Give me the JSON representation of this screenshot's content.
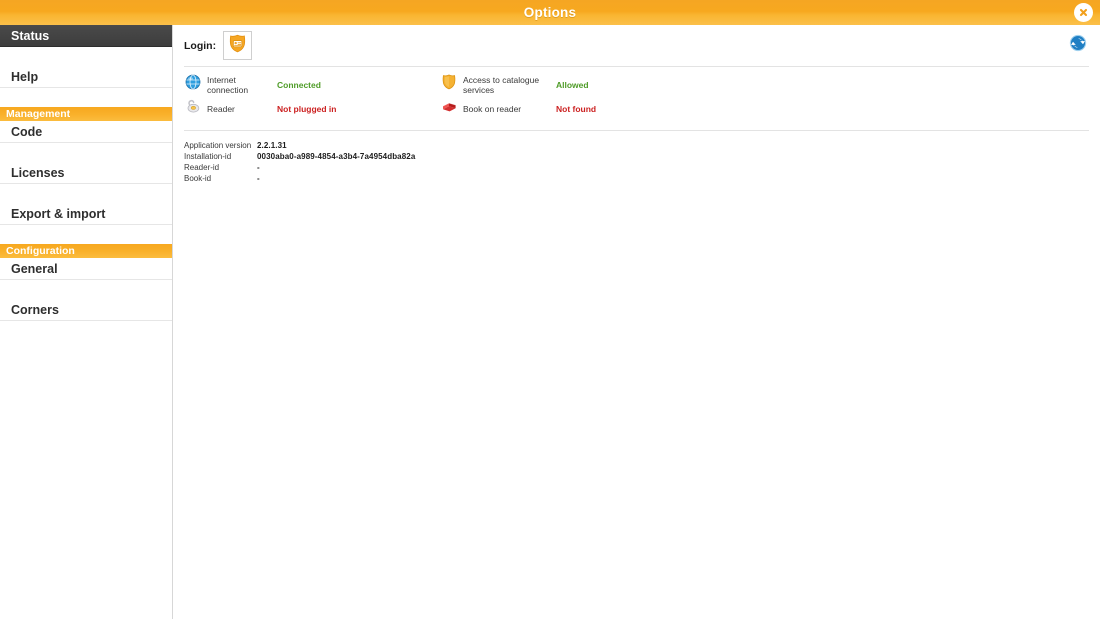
{
  "window": {
    "title": "Options",
    "close_icon": "close-icon",
    "accent": "#f7a81f",
    "active_nav_bg": "#434343"
  },
  "sidebar": {
    "items": [
      {
        "type": "item",
        "label": "Status",
        "active": true,
        "name": "sidebar-item-status"
      },
      {
        "type": "item",
        "label": "Help",
        "active": false,
        "name": "sidebar-item-help"
      },
      {
        "type": "section",
        "label": "Management",
        "active": false,
        "name": "sidebar-section-management"
      },
      {
        "type": "item",
        "label": "Code",
        "active": false,
        "name": "sidebar-item-code"
      },
      {
        "type": "item",
        "label": "Licenses",
        "active": false,
        "name": "sidebar-item-licenses"
      },
      {
        "type": "item",
        "label": "Export & import",
        "active": false,
        "name": "sidebar-item-export-import"
      },
      {
        "type": "section",
        "label": "Configuration",
        "active": false,
        "name": "sidebar-section-configuration"
      },
      {
        "type": "item",
        "label": "General",
        "active": false,
        "name": "sidebar-item-general"
      },
      {
        "type": "item",
        "label": "Corners",
        "active": false,
        "name": "sidebar-item-corners"
      }
    ]
  },
  "main": {
    "login": {
      "label": "Login:",
      "icon": "login-shield-card-icon"
    },
    "refresh_icon": "refresh-icon",
    "status": {
      "rows": [
        {
          "left": {
            "icon": "globe-icon",
            "label": "Internet connection",
            "value": "Connected",
            "state": "ok"
          },
          "right": {
            "icon": "shield-icon",
            "label": "Access to catalogue services",
            "value": "Allowed",
            "state": "ok"
          }
        },
        {
          "left": {
            "icon": "reader-icon",
            "label": "Reader",
            "value": "Not plugged in",
            "state": "bad"
          },
          "right": {
            "icon": "book-icon",
            "label": "Book on reader",
            "value": "Not found",
            "state": "bad"
          }
        }
      ]
    },
    "info": {
      "rows": [
        {
          "key": "Application version",
          "value": "2.2.1.31"
        },
        {
          "key": "Installation-id",
          "value": "0030aba0-a989-4854-a3b4-7a4954dba82a"
        },
        {
          "key": "Reader-id",
          "value": "-"
        },
        {
          "key": "Book-id",
          "value": "-"
        }
      ]
    }
  },
  "colors": {
    "ok": "#4f9c28",
    "bad": "#cc2121"
  }
}
